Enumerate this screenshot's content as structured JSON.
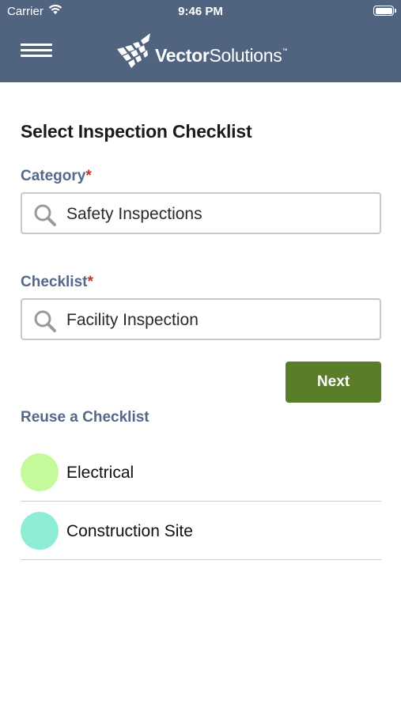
{
  "status_bar": {
    "carrier": "Carrier",
    "time": "9:46 PM"
  },
  "header": {
    "logo_bold": "Vector",
    "logo_light": "Solutions",
    "logo_tm": "™",
    "menu_icon": "hamburger-menu-icon",
    "background_color": "#51647f"
  },
  "page": {
    "title": "Select Inspection Checklist"
  },
  "category": {
    "label": "Category",
    "required_mark": "*",
    "value": "Safety Inspections",
    "icon": "search-icon"
  },
  "checklist": {
    "label": "Checklist",
    "required_mark": "*",
    "value": "Facility Inspection",
    "icon": "search-icon"
  },
  "actions": {
    "next_label": "Next",
    "next_color": "#5a7d29"
  },
  "reuse": {
    "title": "Reuse a Checklist",
    "items": [
      {
        "label": "Electrical",
        "color": "#c5fa9a"
      },
      {
        "label": "Construction Site",
        "color": "#8eedd4"
      }
    ]
  }
}
